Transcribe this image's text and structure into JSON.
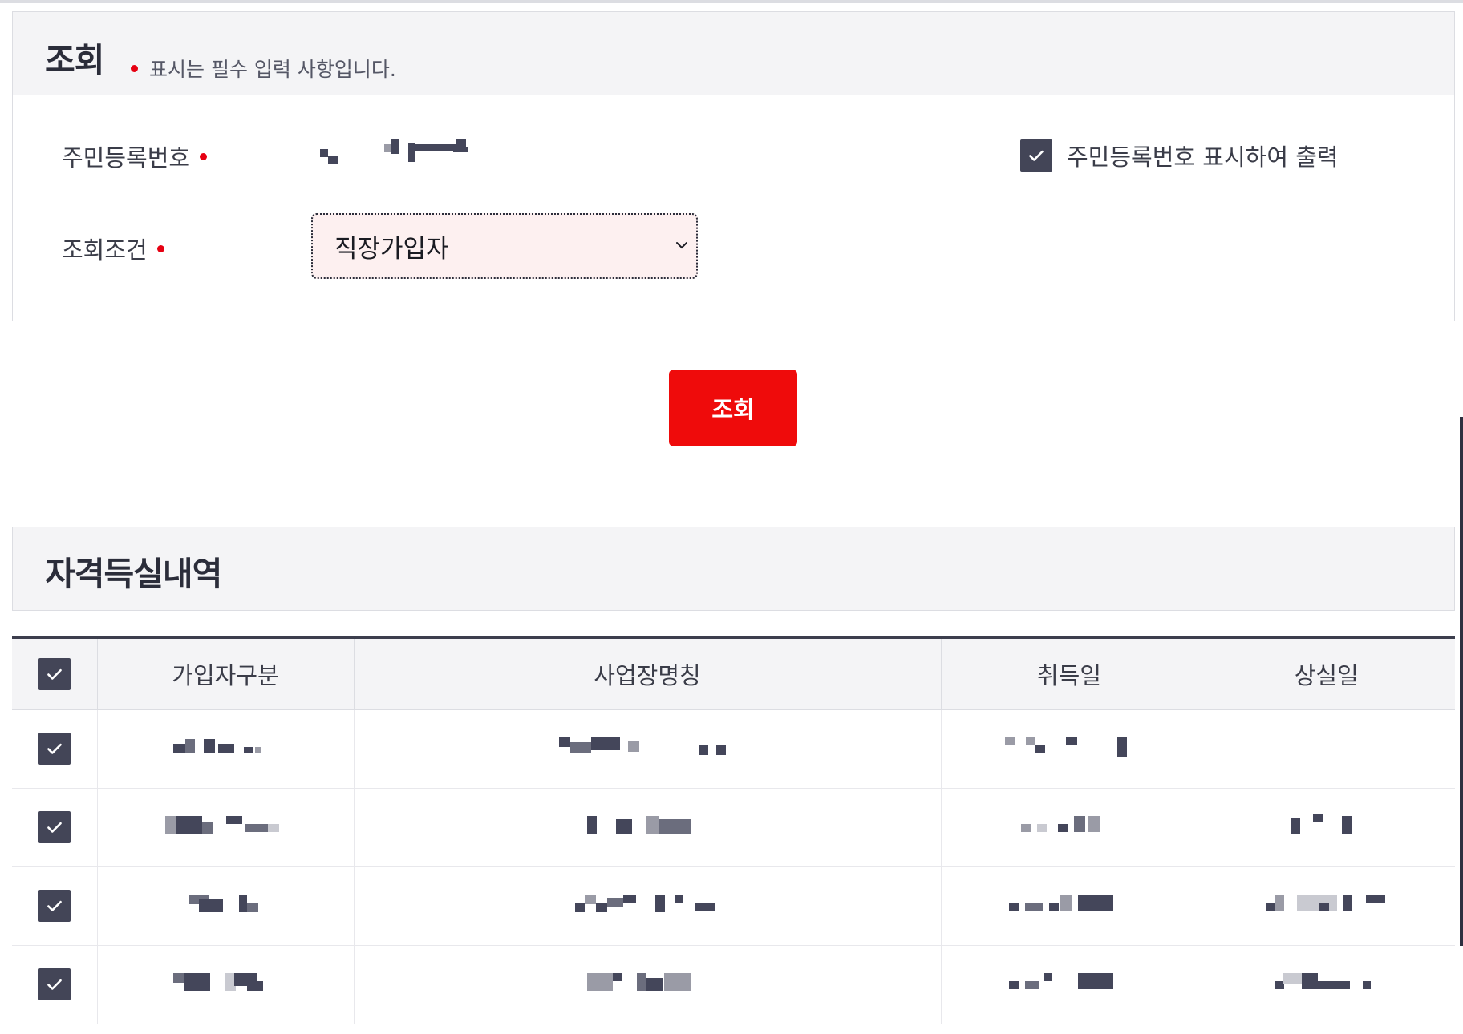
{
  "search_section": {
    "title": "조회",
    "note": "표시는 필수 입력 사항입니다.",
    "fields": {
      "rrn_label": "주민등록번호",
      "condition_label": "조회조건",
      "condition_value": "직장가입자",
      "print_option_label": "주민등록번호 표시하여 출력",
      "print_option_checked": true
    },
    "search_button": "조회"
  },
  "results_section": {
    "title": "자격득실내역",
    "columns": [
      "가입자구분",
      "사업장명칭",
      "취득일",
      "상실일"
    ],
    "header_checked": true,
    "row_count": 4
  },
  "colors": {
    "accent": "#ef0b0b",
    "required_dot": "#e60012",
    "checkbox": "#434557"
  }
}
